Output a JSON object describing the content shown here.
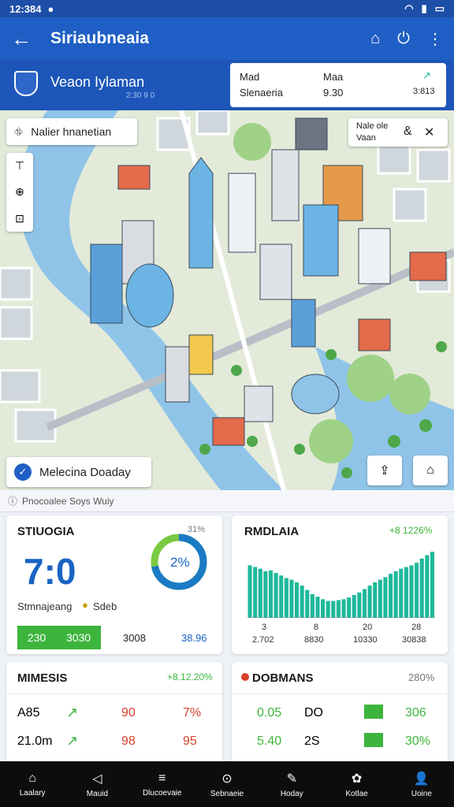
{
  "status": {
    "time": "12:384",
    "icons": [
      "wifi-icon",
      "signal-icon",
      "battery-icon"
    ]
  },
  "app_bar": {
    "title": "Siriaubneaia"
  },
  "header": {
    "user_name": "Veaon Iylaman",
    "user_sub": "2:30 9 0",
    "card": {
      "col1_top": "Mad",
      "col1_bottom": "Slenaeria",
      "col2_top": "Maa",
      "col2_bottom": "9.30",
      "col3_bottom": "3:813"
    }
  },
  "map": {
    "search_label": "Nalier hnanetian",
    "legend": {
      "line1": "Nale ole",
      "line2": "Vaan"
    },
    "measure_label": "Melecina Doaday"
  },
  "section_title": "Pnocoalee Soys Wuiy",
  "card1": {
    "title": "STIUOGIA",
    "corner": "31%",
    "big_number": "7:0",
    "donut_value": "2%",
    "donut_fraction": 0.72,
    "subtitle": "Stmnajeang",
    "subtitle_tag": "Sdeb",
    "btn_left": "230",
    "btn_mid": "3030",
    "val_a": "3008",
    "val_b": "38.96"
  },
  "card2": {
    "title": "RMDLAIA",
    "corner": "+8 1226%",
    "labels": [
      [
        "3",
        "2.702"
      ],
      [
        "8",
        "8830"
      ],
      [
        "20",
        "10330"
      ],
      [
        "28",
        "30838"
      ]
    ]
  },
  "card3": {
    "title": "MIMESIS",
    "corner": "+8.12.20%",
    "rows": [
      [
        "A85",
        "90",
        "7%"
      ],
      [
        "21.0m",
        "98",
        "95"
      ]
    ]
  },
  "card4": {
    "title": "DOBMANS",
    "corner": "280%",
    "rows": [
      [
        "0.05",
        "DO",
        "306"
      ],
      [
        "5.40",
        "2S",
        "30%"
      ]
    ]
  },
  "chart_data": {
    "type": "bar",
    "title": "RMDLAIA",
    "values": [
      62,
      60,
      58,
      55,
      56,
      53,
      50,
      47,
      45,
      42,
      38,
      33,
      28,
      25,
      22,
      20,
      20,
      21,
      22,
      24,
      27,
      30,
      34,
      38,
      42,
      45,
      48,
      52,
      55,
      58,
      60,
      62,
      65,
      70,
      74,
      78
    ],
    "ylim": [
      0,
      80
    ]
  },
  "bottom_nav": [
    {
      "label": "Laalary",
      "icon": "home-icon"
    },
    {
      "label": "Mauid",
      "icon": "send-icon"
    },
    {
      "label": "Dlucoevaie",
      "icon": "list-icon"
    },
    {
      "label": "Sebnaeie",
      "icon": "settings-icon"
    },
    {
      "label": "Hoday",
      "icon": "edit-icon"
    },
    {
      "label": "Kotlae",
      "icon": "apps-icon"
    },
    {
      "label": "Uoine",
      "icon": "user-icon"
    }
  ],
  "colors": {
    "primary": "#1f5ec4",
    "teal": "#1fb89b",
    "green": "#3db53d",
    "red": "#d8412e"
  }
}
